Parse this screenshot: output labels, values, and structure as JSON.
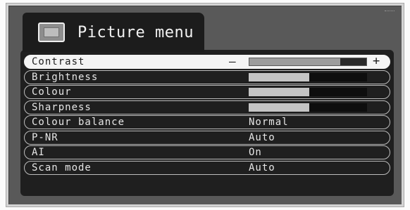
{
  "menu": {
    "title": "Picture menu",
    "icon": "tv-screen-icon"
  },
  "rows": [
    {
      "label": "Contrast",
      "type": "slider",
      "level": 0.78,
      "minus": "—",
      "plus": "+",
      "selected": true
    },
    {
      "label": "Brightness",
      "type": "slider",
      "level": 0.51
    },
    {
      "label": "Colour",
      "type": "slider",
      "level": 0.51
    },
    {
      "label": "Sharpness",
      "type": "slider",
      "level": 0.51
    },
    {
      "label": "Colour balance",
      "type": "value",
      "value": "Normal"
    },
    {
      "label": "P-NR",
      "type": "value",
      "value": "Auto"
    },
    {
      "label": "AI",
      "type": "value",
      "value": "On"
    },
    {
      "label": "Scan mode",
      "type": "value",
      "value": "Auto"
    }
  ],
  "colors": {
    "screen": "#595959",
    "panel": "#1f1f1f",
    "selected_row": "#f4f4f4",
    "text": "#e6e6e6",
    "bar_fill": "#c4c4c4"
  }
}
